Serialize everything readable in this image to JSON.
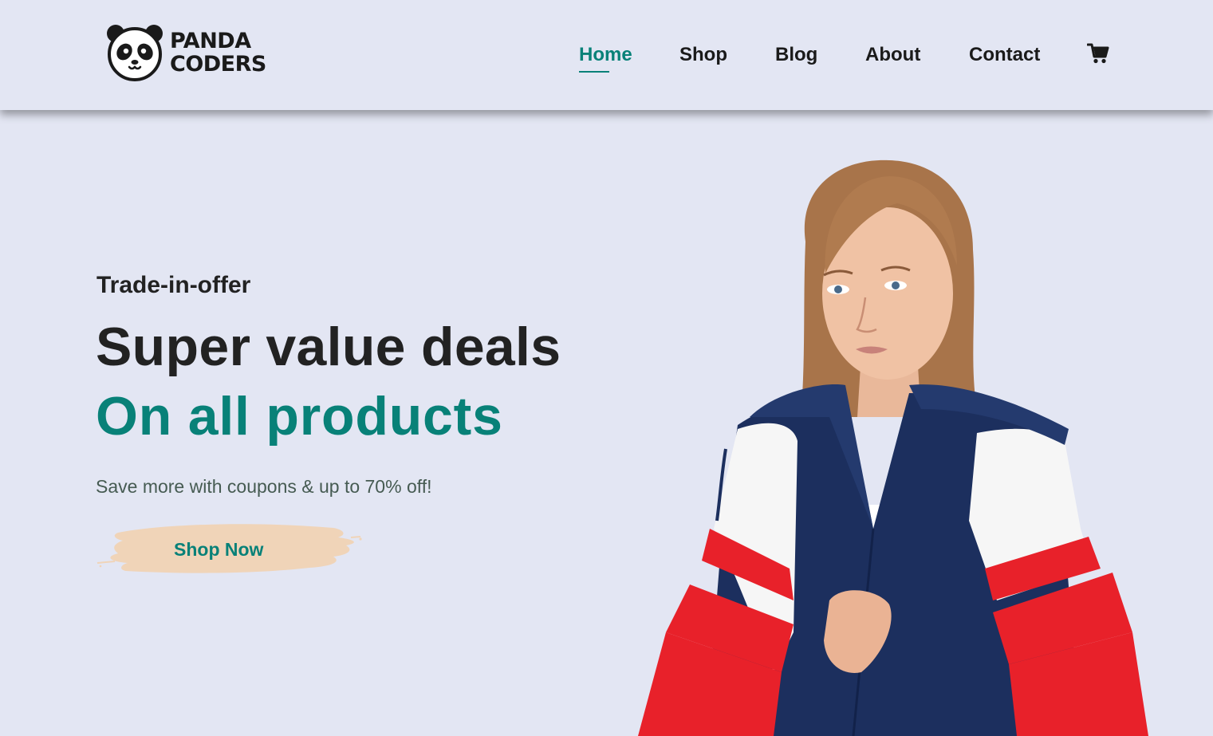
{
  "brand": {
    "line1": "PANDA",
    "line2": "CODERS",
    "logo_icon": "panda-face-icon"
  },
  "nav": {
    "items": [
      {
        "label": "Home",
        "active": true
      },
      {
        "label": "Shop",
        "active": false
      },
      {
        "label": "Blog",
        "active": false
      },
      {
        "label": "About",
        "active": false
      },
      {
        "label": "Contact",
        "active": false
      }
    ],
    "cart_icon": "shopping-cart-icon"
  },
  "hero": {
    "eyebrow": "Trade-in-offer",
    "headline": "Super value deals",
    "headline_accent": "On all products",
    "subtext": "Save more with coupons & up to 70% off!",
    "cta_label": "Shop Now",
    "image": "model-in-red-white-navy-windbreaker"
  },
  "colors": {
    "background": "#e3e6f3",
    "accent": "#088178",
    "text_dark": "#222222",
    "text_muted": "#465b52",
    "cta_brush": "#f0d4b8",
    "jacket_red": "#e8212a",
    "jacket_navy": "#1c2f5e"
  }
}
